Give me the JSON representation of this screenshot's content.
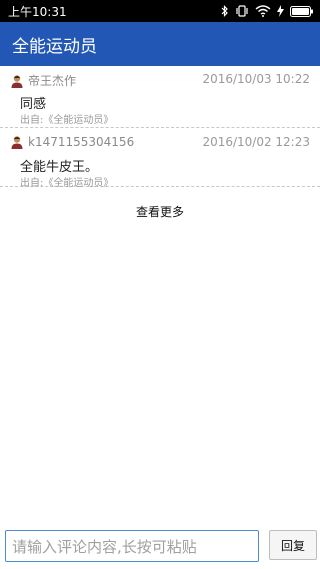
{
  "status_bar": {
    "time": "上午10:31",
    "icons": [
      "bluetooth-icon",
      "vibrate-icon",
      "wifi-icon",
      "charging-icon",
      "battery-icon"
    ]
  },
  "app_bar": {
    "title": "全能运动员",
    "color": "#2257b5"
  },
  "comments": [
    {
      "author": "帝王杰作",
      "time": "2016/10/03 10:22",
      "content": "同感",
      "source": "出自:《全能运动员》",
      "avatar_icon": "user-avatar-icon"
    },
    {
      "author": "k1471155304156",
      "time": "2016/10/02 12:23",
      "content": "全能牛皮王。",
      "source": "出自:《全能运动员》",
      "avatar_icon": "user-avatar-icon"
    }
  ],
  "more_label": "查看更多",
  "reply_bar": {
    "placeholder": "请输入评论内容,长按可粘贴",
    "button_label": "回复"
  }
}
